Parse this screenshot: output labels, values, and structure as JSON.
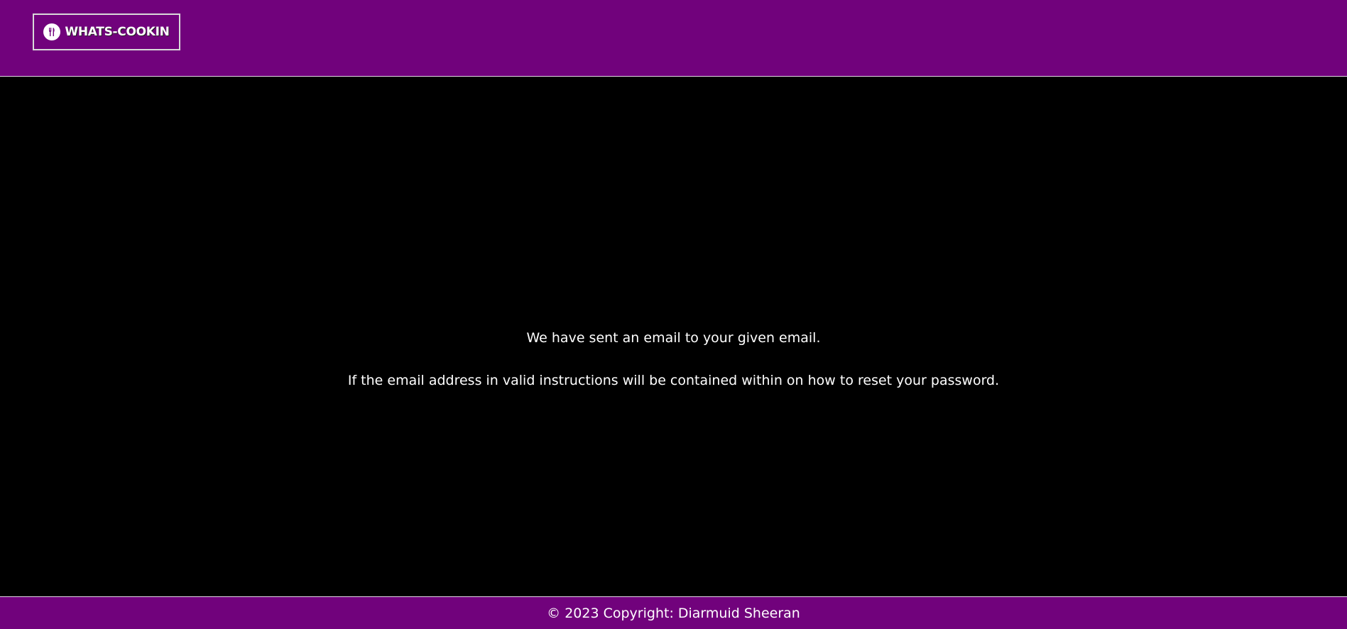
{
  "header": {
    "logo_text": "WHATS-COOKIN",
    "logo_icon": "fork-knife-icon",
    "background_color": "#71027c"
  },
  "main": {
    "message_line_1": "We have sent an email to your given email.",
    "message_line_2": "If the email address in valid instructions will be contained within on how to reset your password."
  },
  "footer": {
    "copyright_text": "© 2023 Copyright: Diarmuid Sheeran"
  }
}
